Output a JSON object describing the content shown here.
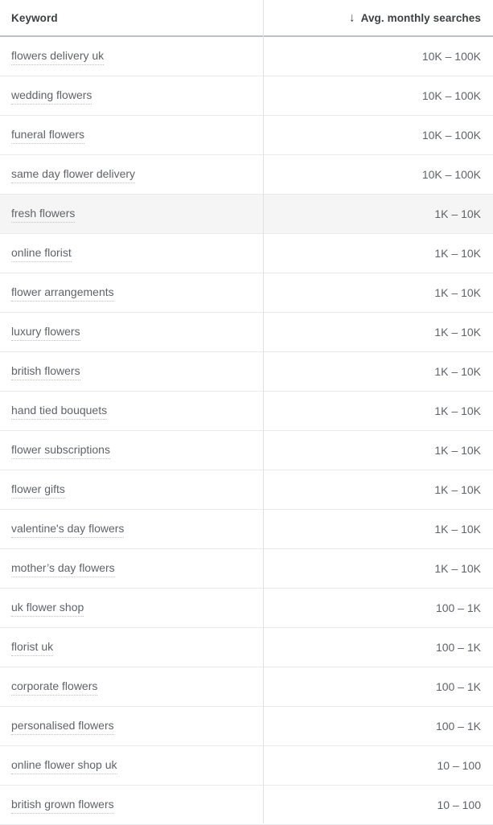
{
  "table": {
    "columns": [
      {
        "id": "keyword",
        "label": "Keyword",
        "align": "left"
      },
      {
        "id": "searches",
        "label": "Avg. monthly searches",
        "align": "right",
        "sort_icon": "arrow-down-icon",
        "sort_glyph": "↓",
        "sorted": "descending"
      }
    ],
    "highlighted_row_index": 4,
    "rows": [
      {
        "keyword": "flowers delivery uk",
        "searches": "10K – 100K"
      },
      {
        "keyword": "wedding flowers",
        "searches": "10K – 100K"
      },
      {
        "keyword": "funeral flowers",
        "searches": "10K – 100K"
      },
      {
        "keyword": "same day flower delivery",
        "searches": "10K – 100K"
      },
      {
        "keyword": "fresh flowers",
        "searches": "1K – 10K"
      },
      {
        "keyword": "online florist",
        "searches": "1K – 10K"
      },
      {
        "keyword": "flower arrangements",
        "searches": "1K – 10K"
      },
      {
        "keyword": "luxury flowers",
        "searches": "1K – 10K"
      },
      {
        "keyword": "british flowers",
        "searches": "1K – 10K"
      },
      {
        "keyword": "hand tied bouquets",
        "searches": "1K – 10K"
      },
      {
        "keyword": "flower subscriptions",
        "searches": "1K – 10K"
      },
      {
        "keyword": "flower gifts",
        "searches": "1K – 10K"
      },
      {
        "keyword": "valentine's day flowers",
        "searches": "1K – 10K"
      },
      {
        "keyword": "mother’s day flowers",
        "searches": "1K – 10K"
      },
      {
        "keyword": "uk flower shop",
        "searches": "100 – 1K"
      },
      {
        "keyword": "florist uk",
        "searches": "100 – 1K"
      },
      {
        "keyword": "corporate flowers",
        "searches": "100 – 1K"
      },
      {
        "keyword": "personalised flowers",
        "searches": "100 – 1K"
      },
      {
        "keyword": "online flower shop uk",
        "searches": "10 – 100"
      },
      {
        "keyword": "british grown flowers",
        "searches": "10 – 100"
      }
    ]
  },
  "colors": {
    "text_primary": "#3c4043",
    "text_secondary": "#5f6368",
    "row_border": "#e8eaed",
    "header_border": "#bdc1c6",
    "column_divider": "#e0e0e0",
    "row_highlight": "#f5f5f5",
    "background": "#ffffff"
  }
}
